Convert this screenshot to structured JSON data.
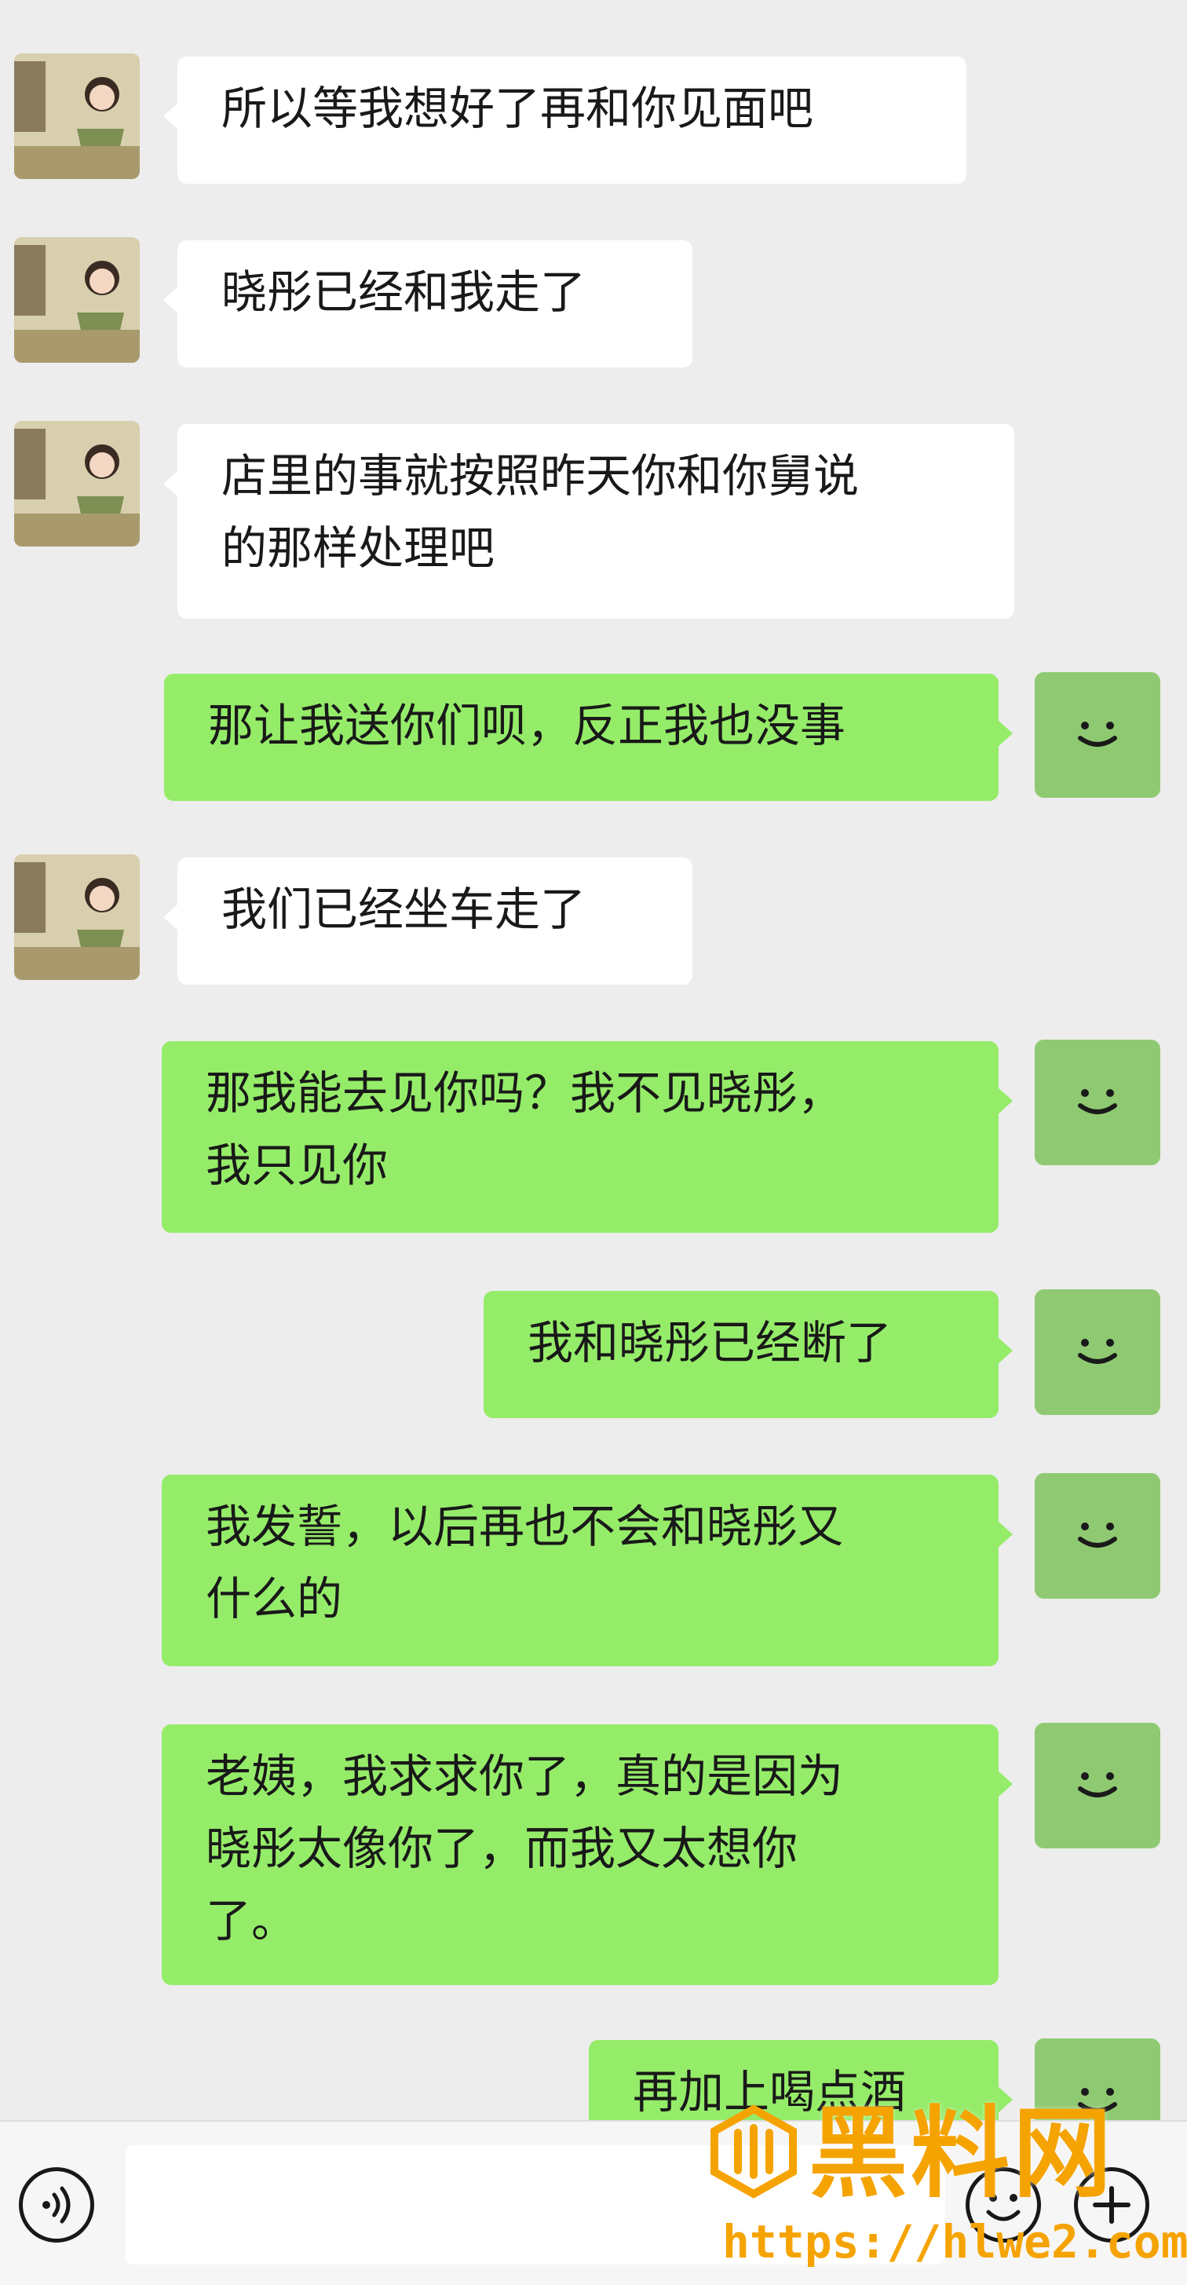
{
  "messages": [
    {
      "side": "in",
      "text": "所以等我想好了再和你见面吧"
    },
    {
      "side": "in",
      "text": "晓彤已经和我走了"
    },
    {
      "side": "in",
      "text": "店里的事就按照昨天你和你舅说\n的那样处理吧"
    },
    {
      "side": "out",
      "text": "那让我送你们呗，反正我也没事"
    },
    {
      "side": "in",
      "text": "我们已经坐车走了"
    },
    {
      "side": "out",
      "text": "那我能去见你吗？我不见晓彤，\n我只见你"
    },
    {
      "side": "out",
      "text": "我和晓彤已经断了"
    },
    {
      "side": "out",
      "text": "我发誓，以后再也不会和晓彤又\n什么的"
    },
    {
      "side": "out",
      "text": "老姨，我求求你了，真的是因为\n晓彤太像你了，而我又太想你\n了。"
    },
    {
      "side": "out",
      "text": "再加上喝点酒"
    }
  ],
  "input": {
    "value": "",
    "placeholder": ""
  },
  "icons": {
    "voice": "voice-icon",
    "emoji": "emoji-icon",
    "plus": "plus-icon",
    "peer_avatar": "avatar-icon",
    "self_avatar": "smile-avatar-icon"
  },
  "colors": {
    "background": "#ededed",
    "incoming_bubble": "#ffffff",
    "outgoing_bubble": "#95ec69",
    "self_avatar": "#8fca72",
    "watermark": "#f5a300"
  },
  "watermark": {
    "name": "黑料网",
    "url": "https://hlwe2.com"
  }
}
